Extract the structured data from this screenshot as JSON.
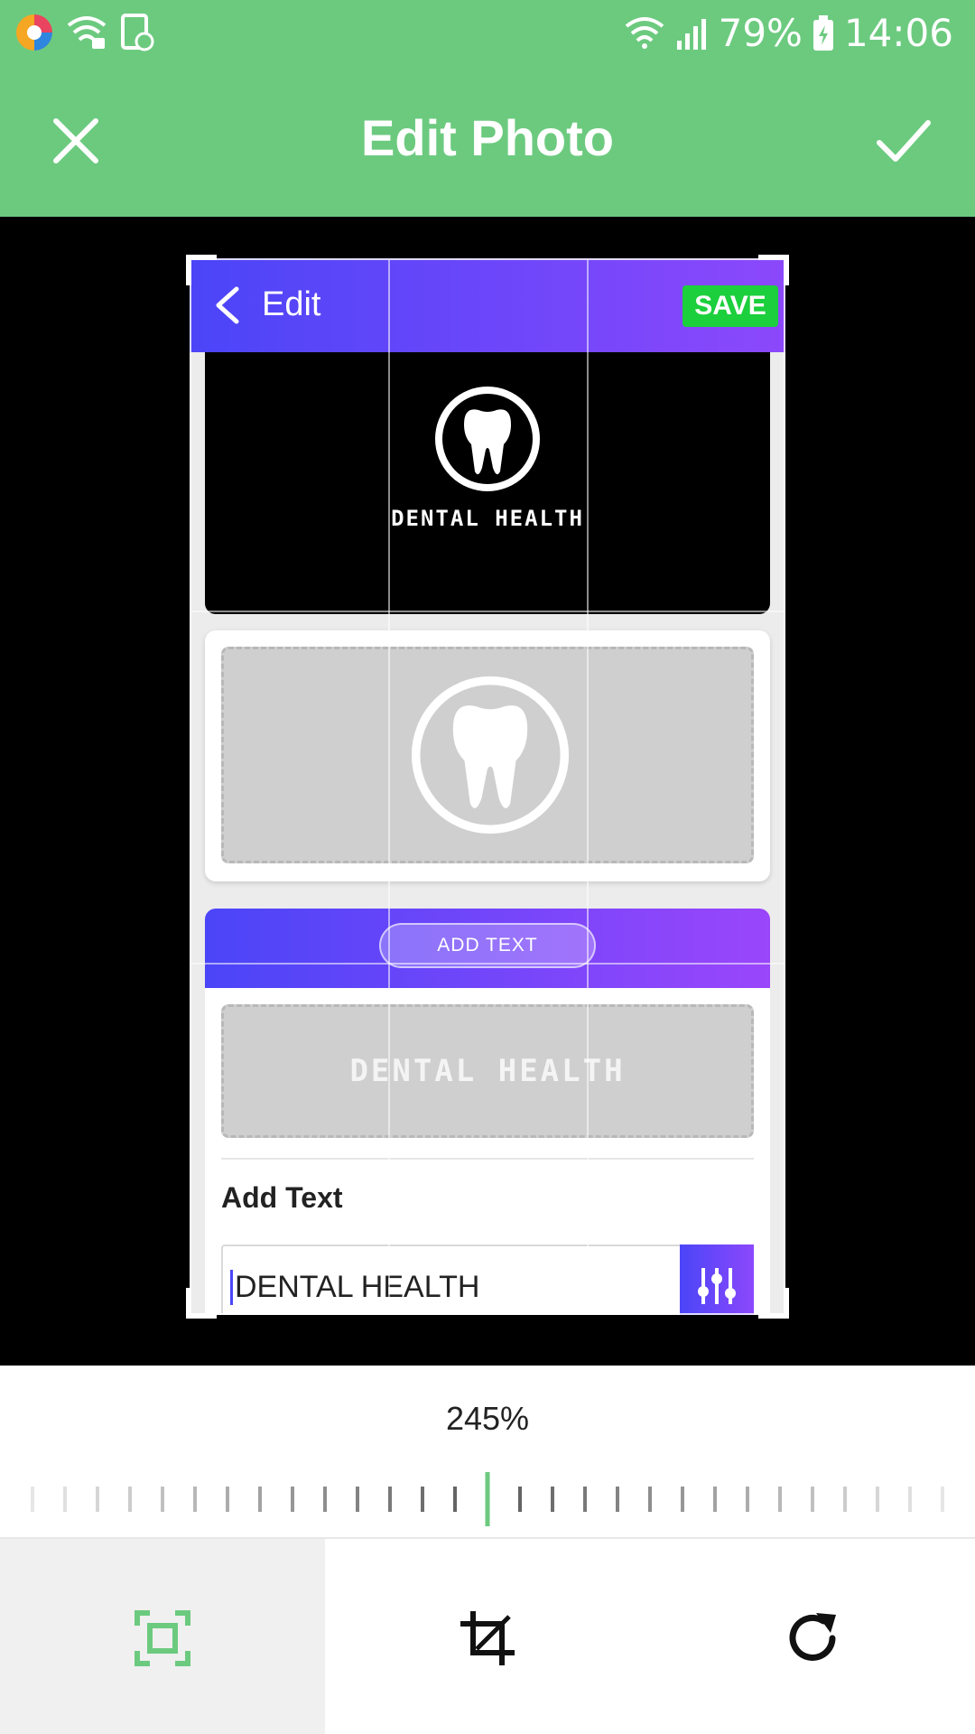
{
  "status_bar": {
    "battery": "79%",
    "time": "14:06"
  },
  "app_bar": {
    "title": "Edit Photo"
  },
  "photo": {
    "header": {
      "edit_label": "Edit",
      "save_label": "SAVE"
    },
    "logo_text": "DENTAL HEALTH",
    "add_text_button": "ADD TEXT",
    "preview_text": "DENTAL HEALTH",
    "section_label": "Add Text",
    "input_value": "DENTAL HEALTH"
  },
  "zoom": {
    "value": "245%"
  },
  "tools": [
    {
      "name": "aspect-fit",
      "active": true
    },
    {
      "name": "crop",
      "active": false
    },
    {
      "name": "rotate",
      "active": false
    }
  ],
  "colors": {
    "accent": "#6CCA7F",
    "gradient_start": "#4b45f8",
    "gradient_end": "#9a46fb",
    "save_green": "#1ccf3c"
  }
}
